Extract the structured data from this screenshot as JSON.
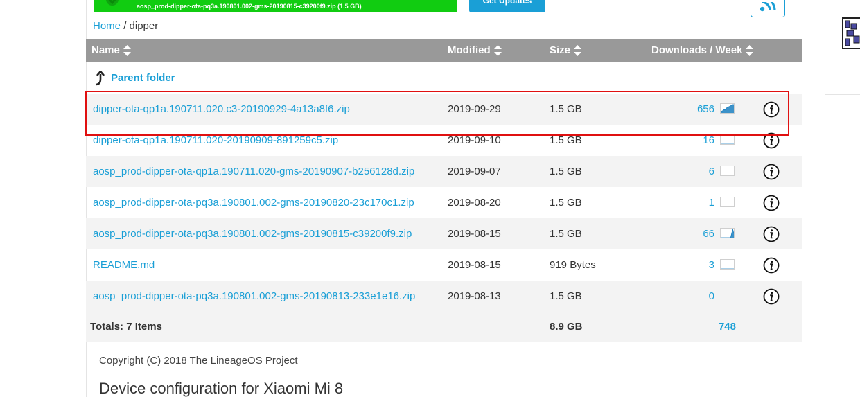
{
  "top": {
    "download_button_label": "aosp_prod-dipper-ota-pq3a.190801.002-gms-20190815-c39200f9.zip (1.5 GB)",
    "updates_button_label": "Get Updates"
  },
  "breadcrumb": {
    "home": "Home",
    "separator": "/",
    "current": "dipper"
  },
  "table": {
    "headers": {
      "name": "Name",
      "modified": "Modified",
      "size": "Size",
      "downloads": "Downloads / Week"
    },
    "parent_folder": "Parent folder",
    "rows": [
      {
        "name": "dipper-ota-qp1a.190711.020.c3-20190929-4a13a8f6.zip",
        "modified": "2019-09-29",
        "size": "1.5 GB",
        "downloads": "656",
        "trend": [
          2,
          3,
          4,
          6,
          5,
          8,
          9,
          10,
          11,
          12,
          13,
          14,
          14
        ]
      },
      {
        "name": "dipper-ota-qp1a.190711.020-20190909-891259c5.zip",
        "modified": "2019-09-10",
        "size": "1.5 GB",
        "downloads": "16",
        "trend": [
          0,
          0,
          0,
          0,
          0,
          0,
          0,
          0,
          0,
          0,
          0,
          0,
          0
        ]
      },
      {
        "name": "aosp_prod-dipper-ota-qp1a.190711.020-gms-20190907-b256128d.zip",
        "modified": "2019-09-07",
        "size": "1.5 GB",
        "downloads": "6",
        "trend": [
          0,
          0,
          0,
          0,
          0,
          0,
          0,
          0,
          0,
          0,
          0,
          0,
          0
        ]
      },
      {
        "name": "aosp_prod-dipper-ota-pq3a.190801.002-gms-20190820-23c170c1.zip",
        "modified": "2019-08-20",
        "size": "1.5 GB",
        "downloads": "1",
        "trend": [
          0,
          0,
          0,
          0,
          0,
          0,
          0,
          0,
          0,
          0,
          0,
          0,
          0
        ]
      },
      {
        "name": "aosp_prod-dipper-ota-pq3a.190801.002-gms-20190815-c39200f9.zip",
        "modified": "2019-08-15",
        "size": "1.5 GB",
        "downloads": "66",
        "trend": [
          0,
          0,
          0,
          0,
          0,
          0,
          0,
          0,
          0,
          0,
          1,
          2,
          1
        ]
      },
      {
        "name": "README.md",
        "modified": "2019-08-15",
        "size": "919 Bytes",
        "downloads": "3",
        "trend": [
          0,
          0,
          0,
          0,
          0,
          0,
          0,
          0,
          0,
          0,
          0,
          0,
          0
        ]
      },
      {
        "name": "aosp_prod-dipper-ota-pq3a.190801.002-gms-20190813-233e1e16.zip",
        "modified": "2019-08-13",
        "size": "1.5 GB",
        "downloads": "0",
        "trend": []
      }
    ],
    "totals": {
      "label": "Totals: 7 Items",
      "size": "8.9 GB",
      "downloads": "748"
    }
  },
  "footer": {
    "copyright": "Copyright (C) 2018 The LineageOS Project",
    "heading": "Device configuration for Xiaomi Mi 8"
  },
  "colors": {
    "link": "#1a9fd6",
    "header_bg": "#999999",
    "download_button": "#11cc11",
    "highlight": "#e01010"
  },
  "icons": {
    "sort": "sort-arrows-icon",
    "parent": "parent-folder-arrow-icon",
    "info": "info-circle-icon",
    "rss": "rss-icon",
    "sparkline": "sparkline-chart-icon"
  }
}
